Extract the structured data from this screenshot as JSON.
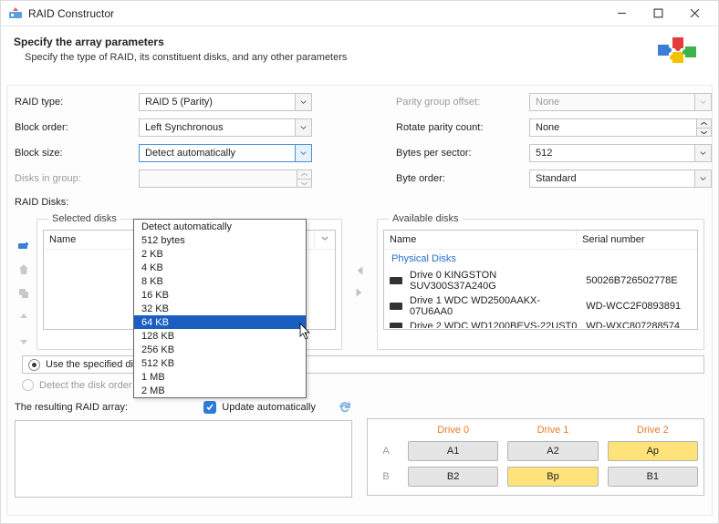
{
  "window": {
    "title": "RAID Constructor"
  },
  "header": {
    "title": "Specify the array parameters",
    "subtitle": "Specify the type of RAID, its constituent disks, and any other parameters"
  },
  "left_form": {
    "raid_type": {
      "label": "RAID type:",
      "value": "RAID 5 (Parity)"
    },
    "block_order": {
      "label": "Block order:",
      "value": "Left Synchronous"
    },
    "block_size": {
      "label": "Block size:",
      "value": "Detect automatically"
    },
    "disks_in_group": {
      "label": "Disks in group:",
      "value": ""
    },
    "raid_disks": {
      "label": "RAID Disks:"
    }
  },
  "right_form": {
    "parity_offset": {
      "label": "Parity group offset:",
      "value": "None"
    },
    "rotate_parity": {
      "label": "Rotate parity count:",
      "value": "None"
    },
    "bytes_sector": {
      "label": "Bytes per sector:",
      "value": "512"
    },
    "byte_order": {
      "label": "Byte order:",
      "value": "Standard"
    }
  },
  "block_size_options": [
    "Detect automatically",
    "512 bytes",
    "2 KB",
    "4 KB",
    "8 KB",
    "16 KB",
    "32 KB",
    "64 KB",
    "128 KB",
    "256 KB",
    "512 KB",
    "1 MB",
    "2 MB"
  ],
  "block_size_highlight_index": 7,
  "selected_disks": {
    "legend": "Selected disks",
    "columns": [
      "Name"
    ],
    "rows": []
  },
  "available_disks": {
    "legend": "Available disks",
    "columns": [
      "Name",
      "Serial number"
    ],
    "group_label": "Physical Disks",
    "rows": [
      {
        "name": "Drive 0 KINGSTON SUV300S37A240G",
        "serial": "50026B726502778E"
      },
      {
        "name": "Drive 1 WDC WD2500AAKX-07U6AA0",
        "serial": "WD-WCC2F0893891"
      },
      {
        "name": "Drive 2 WDC WD1200BEVS-22UST0",
        "serial": "WD-WXC807288574"
      }
    ]
  },
  "order_options": {
    "specified": "Use the specified disk order",
    "detect": "Detect the disk order automatically"
  },
  "resulting": {
    "label": "The resulting RAID array:",
    "update_label": "Update automatically"
  },
  "drive_layout": {
    "headers": [
      "Drive 0",
      "Drive 1",
      "Drive 2"
    ],
    "rows": [
      {
        "label": "A",
        "cells": [
          {
            "t": "A1",
            "p": false
          },
          {
            "t": "A2",
            "p": false
          },
          {
            "t": "Ap",
            "p": true
          }
        ]
      },
      {
        "label": "B",
        "cells": [
          {
            "t": "B2",
            "p": false
          },
          {
            "t": "Bp",
            "p": true
          },
          {
            "t": "B1",
            "p": false
          }
        ]
      }
    ]
  }
}
